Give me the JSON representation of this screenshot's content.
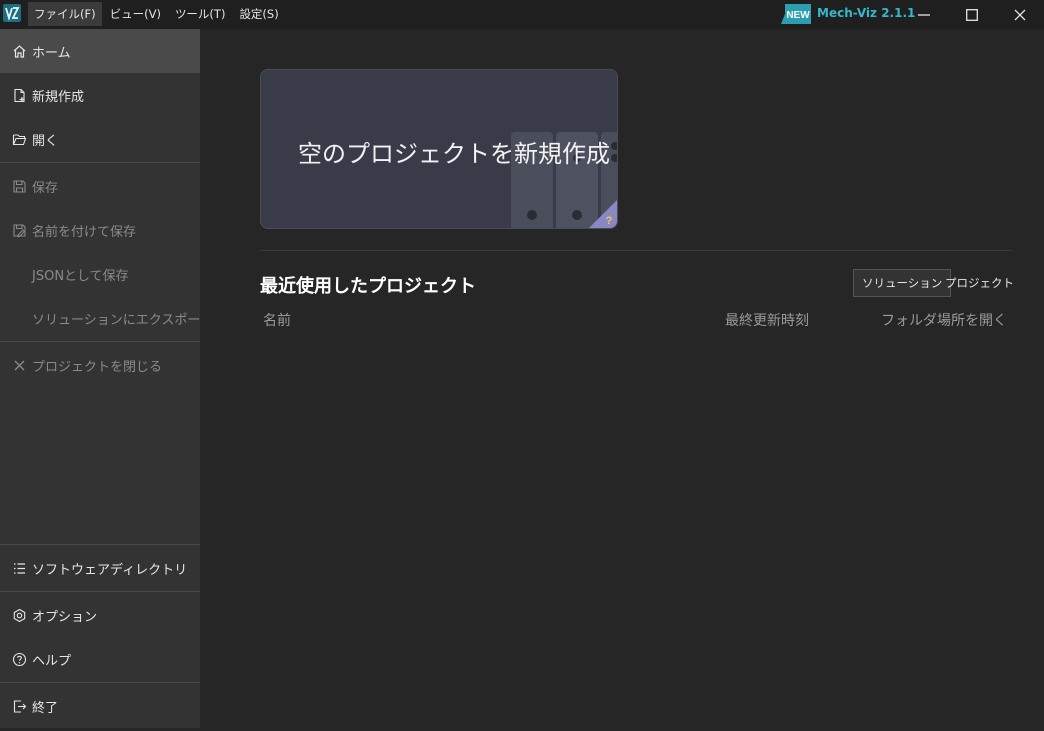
{
  "titlebar": {
    "menu": [
      {
        "label": "ファイル(F)",
        "active": true
      },
      {
        "label": "ビュー(V)",
        "active": false
      },
      {
        "label": "ツール(T)",
        "active": false
      },
      {
        "label": "設定(S)",
        "active": false
      }
    ],
    "new_badge": "NEW",
    "version": "Mech-Viz 2.1.1",
    "accent_color": "#35b8c8"
  },
  "sidebar": {
    "items": [
      {
        "label": "ホーム",
        "icon": "home-icon"
      },
      {
        "label": "新規作成",
        "icon": "new-file-icon"
      },
      {
        "label": "開く",
        "icon": "folder-open-icon"
      },
      {
        "label": "保存",
        "icon": "save-icon"
      },
      {
        "label": "名前を付けて保存",
        "icon": "save-as-icon"
      },
      {
        "label": "JSONとして保存"
      },
      {
        "label": "ソリューションにエクスポート"
      },
      {
        "label": "プロジェクトを閉じる",
        "icon": "close-icon"
      },
      {
        "label": "ソフトウェアディレクトリ",
        "icon": "list-icon"
      },
      {
        "label": "オプション",
        "icon": "hexagon-settings-icon"
      },
      {
        "label": "ヘルプ",
        "icon": "help-icon"
      },
      {
        "label": "終了",
        "icon": "exit-icon"
      }
    ]
  },
  "main": {
    "hero_title": "空のプロジェクトを新規作成",
    "hero_help": "?",
    "recent_title": "最近使用したプロジェクト",
    "toggle": {
      "solution": "ソリューション",
      "project": "プロジェクト"
    },
    "columns": {
      "name": "名前",
      "last_updated": "最終更新時刻",
      "open_folder": "フォルダ場所を開く"
    }
  }
}
